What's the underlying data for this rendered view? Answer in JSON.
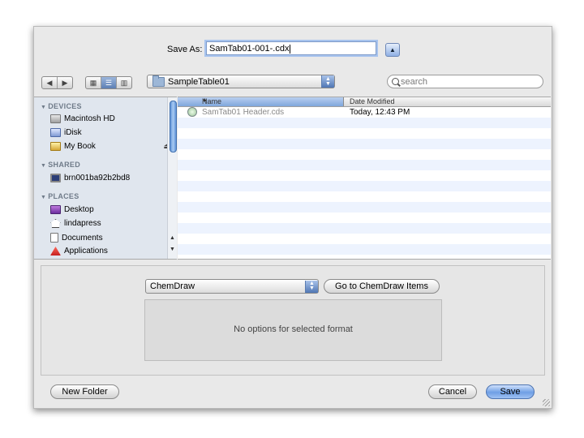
{
  "save_as": {
    "label": "Save As:",
    "filename": "SamTab01-001-.cdx"
  },
  "path_popup": {
    "current_folder": "SampleTable01"
  },
  "search": {
    "placeholder": "search"
  },
  "sidebar": {
    "sections": [
      {
        "title": "DEVICES",
        "items": [
          {
            "label": "Macintosh HD",
            "icon": "hard-drive-icon"
          },
          {
            "label": "iDisk",
            "icon": "idisk-icon"
          },
          {
            "label": "My Book",
            "icon": "external-drive-icon",
            "ejectable": true
          }
        ]
      },
      {
        "title": "SHARED",
        "items": [
          {
            "label": "brn001ba92b2bd8",
            "icon": "computer-icon"
          }
        ]
      },
      {
        "title": "PLACES",
        "items": [
          {
            "label": "Desktop",
            "icon": "desktop-icon"
          },
          {
            "label": "lindapress",
            "icon": "home-icon"
          },
          {
            "label": "Documents",
            "icon": "documents-icon"
          },
          {
            "label": "Applications",
            "icon": "applications-icon"
          }
        ]
      }
    ]
  },
  "file_list": {
    "columns": [
      "Name",
      "Date Modified"
    ],
    "rows": [
      {
        "name": "SamTab01 Header.cds",
        "date": "Today, 12:43 PM",
        "dimmed": true
      }
    ]
  },
  "format": {
    "selected": "ChemDraw",
    "goto_button": "Go to ChemDraw Items",
    "no_options_text": "No options for selected format"
  },
  "buttons": {
    "new_folder": "New Folder",
    "cancel": "Cancel",
    "save": "Save"
  },
  "colors": {
    "accent_blue": "#6f9fe5",
    "sidebar_bg": "#e0e6ee",
    "stripe": "#edf3fe"
  }
}
